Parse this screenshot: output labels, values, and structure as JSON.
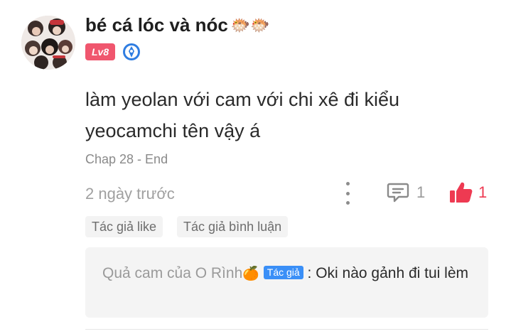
{
  "comment": {
    "username": "bé cá lóc và nóc",
    "username_emoji": "🐡🐡",
    "level_badge": "Lv8",
    "text": "làm yeolan với cam với chi xê đi kiểu yeocamchi tên vậy á",
    "chapter": "Chap 28 - End",
    "time": "2 ngày trước",
    "reply_count": "1",
    "like_count": "1",
    "tags": [
      "Tác giả like",
      "Tác giả bình luận"
    ]
  },
  "reply": {
    "author": "Quả cam của O Rình",
    "author_emoji": "🍊",
    "author_tag": "Tác giả",
    "separator": " : ",
    "text": "Oki nào gảnh đi tui lèm"
  },
  "colors": {
    "level_badge": "#f0566e",
    "like": "#ee3a52",
    "author_tag": "#3a8ff7",
    "verified": "#2f7de1"
  },
  "icons": {
    "verified": "verified-badge-icon",
    "more": "more-vertical-icon",
    "reply": "comment-bubble-icon",
    "like": "thumbs-up-icon"
  }
}
